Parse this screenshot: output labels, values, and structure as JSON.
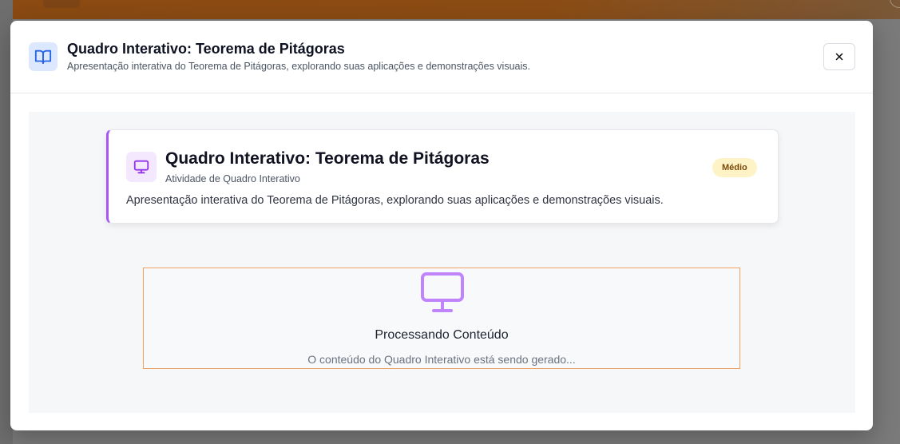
{
  "modal": {
    "title": "Quadro Interativo: Teorema de Pitágoras",
    "subtitle": "Apresentação interativa do Teorema de Pitágoras, explorando suas aplicações e demonstrações visuais.",
    "close_icon": "close-icon",
    "header_icon": "book-open-icon"
  },
  "card": {
    "icon": "monitor-icon",
    "title": "Quadro Interativo: Teorema de Pitágoras",
    "type": "Atividade de Quadro Interativo",
    "badge": "Médio",
    "description": "Apresentação interativa do Teorema de Pitágoras, explorando suas aplicações e demonstrações visuais."
  },
  "processing": {
    "icon": "monitor-icon",
    "title": "Processando Conteúdo",
    "message": "O conteúdo do Quadro Interativo está sendo gerado..."
  },
  "colors": {
    "accent_purple": "#a855f7",
    "header_icon_blue": "#2563eb",
    "badge_bg": "#fef3c7",
    "processing_border": "#f0a060"
  }
}
